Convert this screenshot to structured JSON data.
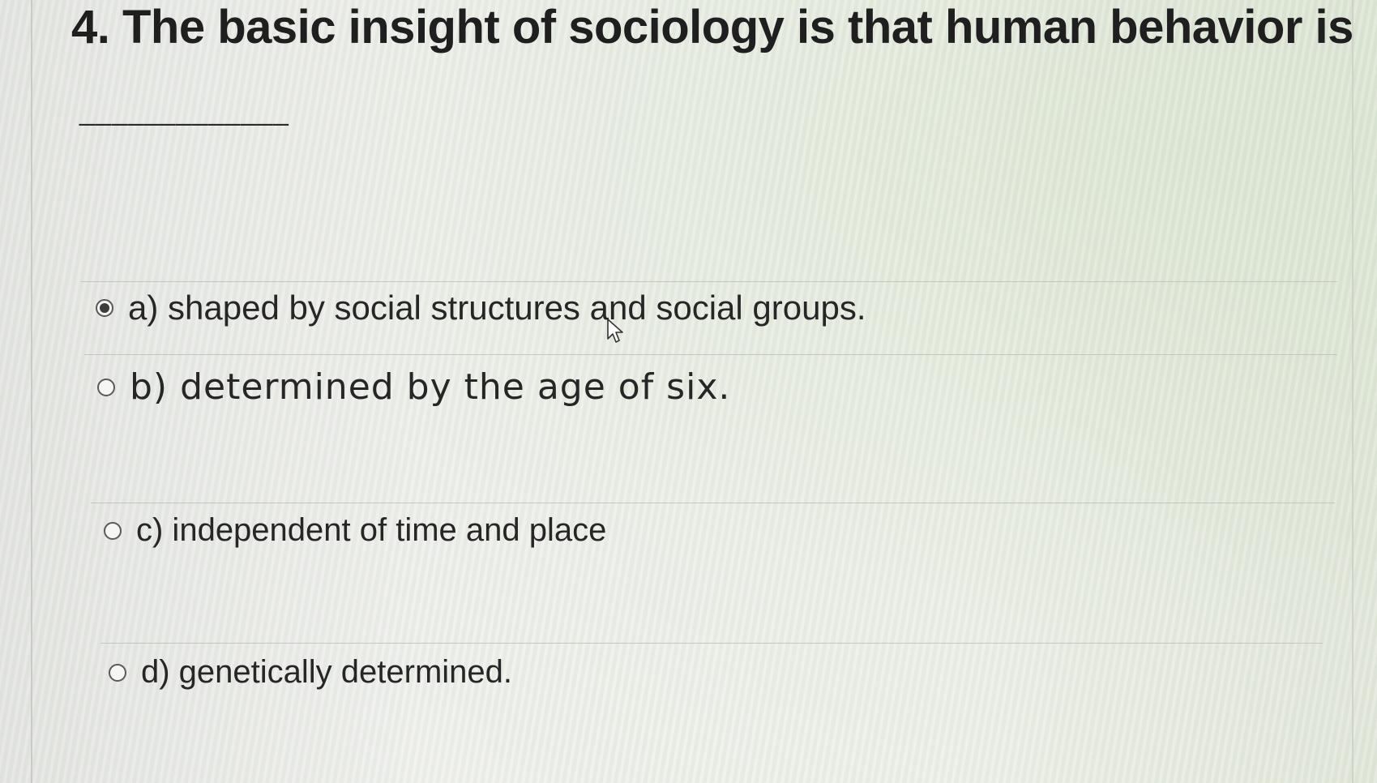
{
  "question": {
    "text": "4. The basic insight of sociology is that human behavior is",
    "blank": "_____________"
  },
  "options": [
    {
      "label": "a) shaped by social structures and social groups.",
      "selected": true
    },
    {
      "label": "b) determined by the age of six.",
      "selected": false
    },
    {
      "label": "c) independent of time and place",
      "selected": false
    },
    {
      "label": "d)  genetically determined.",
      "selected": false
    }
  ],
  "icons": {
    "radio_selected": "radio-selected-icon",
    "radio_unselected": "radio-unselected-icon",
    "cursor": "mouse-pointer-icon"
  },
  "colors": {
    "text": "#262626",
    "divider": "#c3c7c0",
    "background": "#eceee9"
  }
}
